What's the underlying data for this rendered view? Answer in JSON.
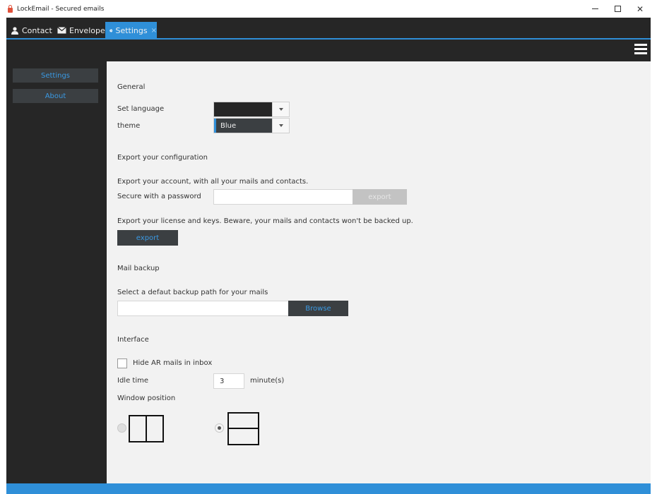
{
  "window": {
    "title": "LockEmail - Secured emails",
    "minimize": "–",
    "maximize": "☐",
    "close": "✕"
  },
  "tabs": [
    {
      "label": "Contact",
      "icon": "person-icon"
    },
    {
      "label": "Envelopes",
      "icon": "envelope-icon"
    },
    {
      "label": "Settings",
      "icon": "gear-icon",
      "active": true,
      "close": "×"
    }
  ],
  "sidebar": {
    "items": [
      {
        "label": "Settings"
      },
      {
        "label": "About"
      }
    ]
  },
  "general": {
    "heading": "General",
    "language_label": "Set language",
    "language_value": "",
    "theme_label": "theme",
    "theme_value": "Blue"
  },
  "export": {
    "heading": "Export your configuration",
    "account_text": "Export your account, with all your mails and contacts.",
    "password_label": "Secure with a password",
    "password_value": "",
    "export_account_button": "export",
    "license_text": "Export your license and keys. Beware, your mails and contacts won't be backed up.",
    "export_license_button": "export"
  },
  "backup": {
    "heading": "Mail backup",
    "path_label": "Select a defaut backup path for your mails",
    "path_value": "",
    "browse_button": "Browse"
  },
  "interface": {
    "heading": "Interface",
    "hide_ar_label": "Hide AR mails in inbox",
    "hide_ar_checked": false,
    "idle_label": "Idle time",
    "idle_value": "3",
    "idle_unit": "minute(s)",
    "window_position_label": "Window position",
    "window_position_selected": "horizontal-split"
  },
  "colors": {
    "accent": "#2f8fd8",
    "dark": "#262626",
    "panel": "#f2f2f2",
    "button": "#3b3f42",
    "button_text": "#3a99e3"
  }
}
